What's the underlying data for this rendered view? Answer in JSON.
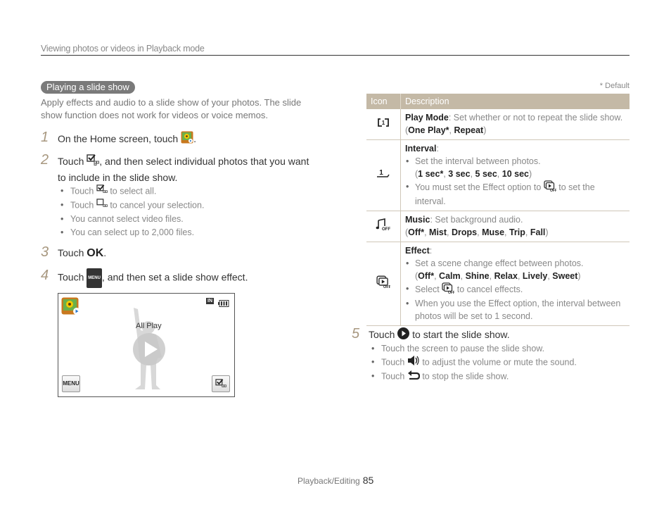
{
  "header": {
    "title": "Viewing photos or videos in Playback mode"
  },
  "section": {
    "title": "Playing a slide show",
    "intro": "Apply effects and audio to a slide show of your photos. The slide show function does not work for videos or voice memos."
  },
  "steps": [
    {
      "num": "1",
      "before": "On the Home screen, touch",
      "after": ".",
      "icon": "album-icon"
    },
    {
      "num": "2",
      "before": "Touch",
      "after": ", and then select individual photos that you want to include in the slide show.",
      "icon": "select-all-icon",
      "bullets": [
        {
          "before": "Touch",
          "after": "to select all.",
          "icon": "select-all-icon"
        },
        {
          "before": "Touch",
          "after": "to cancel your selection.",
          "icon": "deselect-icon"
        },
        {
          "text": "You cannot select video files."
        },
        {
          "text": "You can select up to 2,000 files."
        }
      ]
    },
    {
      "num": "3",
      "before": "Touch",
      "ok": "OK",
      "after": "."
    },
    {
      "num": "4",
      "before": "Touch",
      "menu": "MENU",
      "after": ", and then set a slide show effect."
    },
    {
      "num": "5",
      "before": "Touch",
      "after": "to start the slide show.",
      "icon": "play-circle-icon",
      "bullets": [
        {
          "text": "Touch the screen to pause the slide show."
        },
        {
          "before": "Touch",
          "after": "to adjust the volume or mute the sound.",
          "icon": "volume-icon"
        },
        {
          "before": "Touch",
          "after": "to stop the slide show.",
          "icon": "back-icon"
        }
      ]
    }
  ],
  "screen": {
    "center_label": "All Play",
    "menu_button": "MENU",
    "memory_icon": "IN",
    "battery": "full"
  },
  "table": {
    "default_note": "* Default",
    "headers": [
      "Icon",
      "Description"
    ],
    "rows": [
      {
        "icon": "repeat-icon",
        "name": "Play Mode",
        "desc": ": Set whether or not to repeat the slide show.",
        "options": [
          "One Play*",
          "Repeat"
        ]
      },
      {
        "icon": "interval-icon",
        "name": "Interval",
        "desc": ":",
        "b1": "Set the interval between photos.",
        "options": [
          "1 sec*",
          "3 sec",
          "5 sec",
          "10 sec"
        ],
        "b2_before": "You must set the Effect option to",
        "b2_after": "to set the interval."
      },
      {
        "icon": "music-off-icon",
        "name": "Music",
        "desc": ": Set background audio.",
        "options": [
          "Off*",
          "Mist",
          "Drops",
          "Muse",
          "Trip",
          "Fall"
        ]
      },
      {
        "icon": "effect-off-icon",
        "name": "Effect",
        "desc": ":",
        "b1": "Set a scene change effect between photos.",
        "options": [
          "Off*",
          "Calm",
          "Shine",
          "Relax",
          "Lively",
          "Sweet"
        ],
        "b2_before": "Select",
        "b2_after": "to cancel effects.",
        "b3": "When you use the Effect option, the interval between photos will be set to 1 second."
      }
    ]
  },
  "footer": {
    "section": "Playback/Editing",
    "page": "85"
  },
  "colors": {
    "table_header": "#c4b9a6",
    "step_number": "#a89880",
    "pill": "#7a7a7a"
  }
}
